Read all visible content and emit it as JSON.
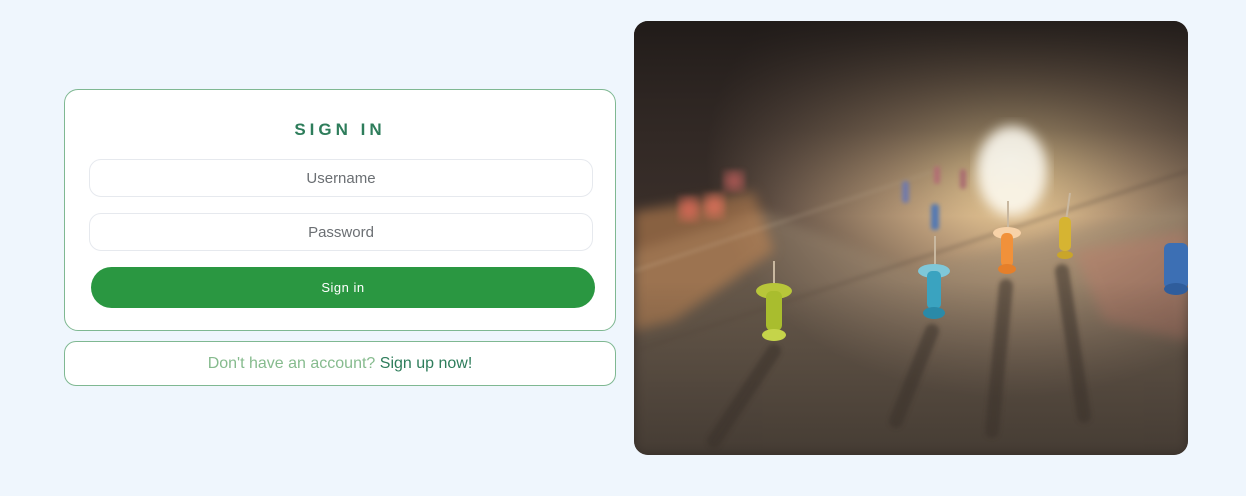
{
  "signin": {
    "title": "SIGN IN",
    "username_placeholder": "Username",
    "password_placeholder": "Password",
    "submit_label": "Sign in"
  },
  "signup": {
    "question": "Don't have an account?",
    "link_label": "Sign up now!"
  },
  "hero": {
    "description": "map-with-push-pins-photo"
  },
  "colors": {
    "background": "#eff6fd",
    "accent_green": "#2a9741",
    "title_green": "#2e7d5b",
    "card_border": "#7fb892"
  }
}
